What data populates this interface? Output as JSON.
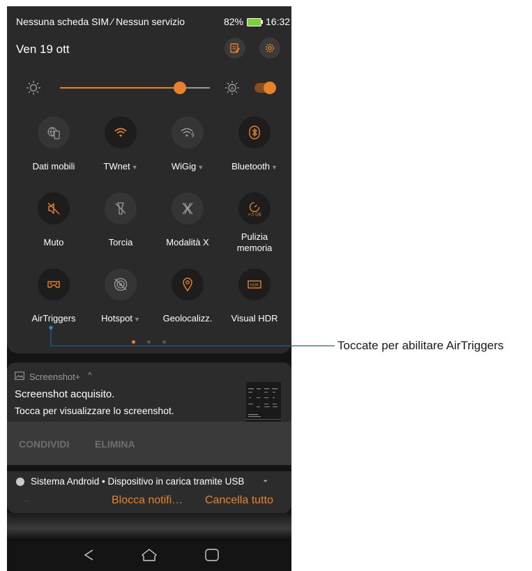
{
  "status_bar": {
    "carrier": "Nessuna scheda SIM ∕ Nessun servizio",
    "battery": "82%",
    "time": "16:32"
  },
  "date": "Ven 19 ott",
  "brightness": {
    "level": 0.8,
    "auto_enabled": true
  },
  "tiles": [
    {
      "label": "Dati mobili",
      "icon": "globe-phone-icon",
      "has_menu": false,
      "active": false
    },
    {
      "label": "TWnet",
      "icon": "wifi-icon",
      "has_menu": true,
      "active": true
    },
    {
      "label": "WiGig",
      "icon": "wigig-icon",
      "has_menu": true,
      "active": false
    },
    {
      "label": "Bluetooth",
      "icon": "bluetooth-icon",
      "has_menu": true,
      "active": true
    },
    {
      "label": "Muto",
      "icon": "mute-icon",
      "has_menu": false,
      "active": true
    },
    {
      "label": "Torcia",
      "icon": "flashlight-icon",
      "has_menu": false,
      "active": false
    },
    {
      "label": "Modalità X",
      "icon": "x-mode-icon",
      "has_menu": false,
      "active": false
    },
    {
      "label": "Pulizia memoria",
      "icon": "memory-clean-icon",
      "has_menu": false,
      "active": true,
      "badge": ">3 GB"
    },
    {
      "label": "AirTriggers",
      "icon": "airtriggers-icon",
      "has_menu": false,
      "active": true
    },
    {
      "label": "Hotspot",
      "icon": "hotspot-icon",
      "has_menu": true,
      "active": false
    },
    {
      "label": "Geolocalizz.",
      "icon": "location-pin-icon",
      "has_menu": false,
      "active": true
    },
    {
      "label": "Visual HDR",
      "icon": "hdr-icon",
      "has_menu": false,
      "active": true,
      "badge": "HDR"
    }
  ],
  "page_indicator": {
    "count": 3,
    "current": 1
  },
  "screenshot_notification": {
    "app": "Screenshot+",
    "title": "Screenshot acquisito.",
    "text": "Tocca per visualizzare lo screenshot.",
    "actions": [
      "CONDIVIDI",
      "ELIMINA"
    ]
  },
  "android_notification": {
    "text": "Sistema Android • Dispositivo in carica tramite USB"
  },
  "notification_actions": {
    "block": "Blocca notifi…",
    "clear": "Cancella tutto"
  },
  "annotation": "Toccate per abilitare AirTriggers",
  "colors": {
    "accent": "#e8822a",
    "panel": "#2a2a2a",
    "background": "#141414",
    "tile_off": "#353535"
  }
}
